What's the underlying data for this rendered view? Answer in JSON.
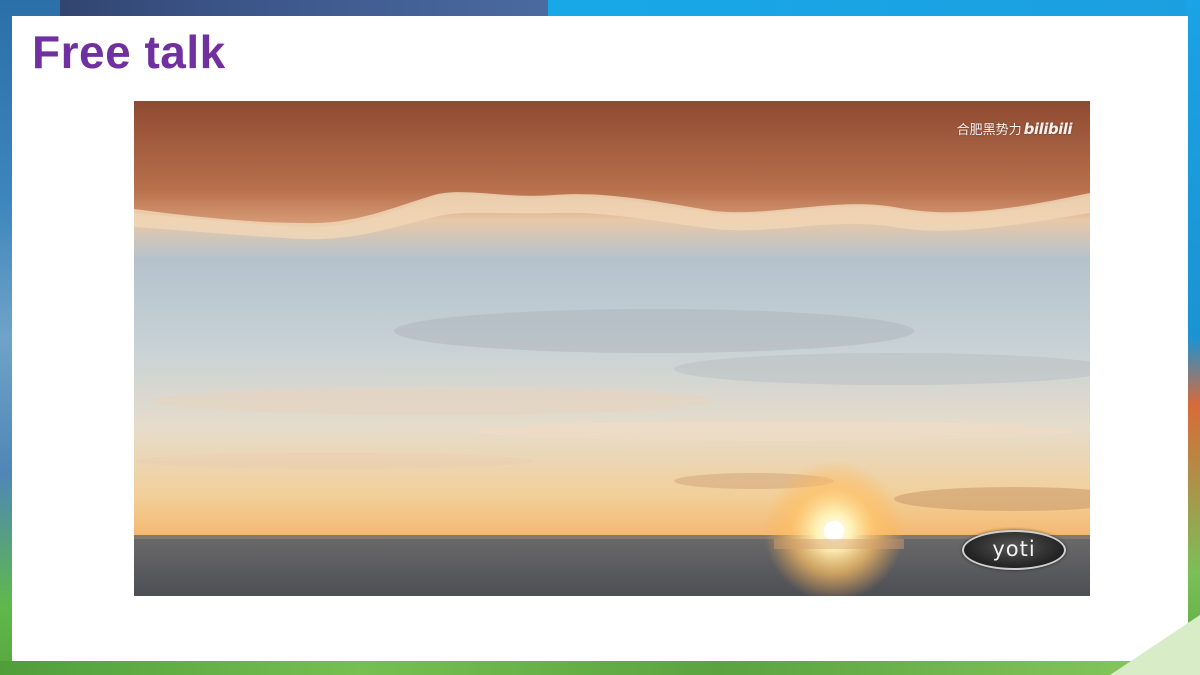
{
  "slide": {
    "title": "Free talk"
  },
  "video": {
    "watermark_text": "合肥黑势力",
    "watermark_brand": "bilibili",
    "logo_text": "yoti"
  },
  "colors": {
    "title": "#7030a0",
    "slide_background": "#ffffff",
    "backdrop_blue": "#1e86c8",
    "backdrop_green": "#6cc24a"
  }
}
